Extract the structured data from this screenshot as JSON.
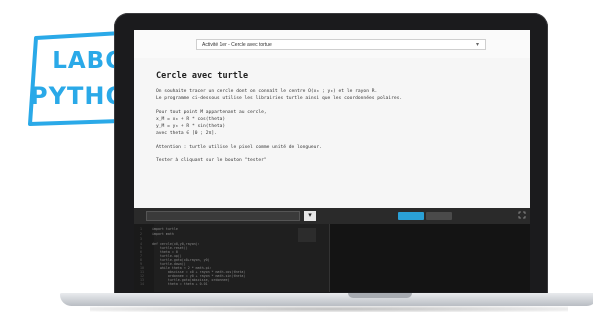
{
  "logo": {
    "line1": "LABO",
    "line2": "PYTHON",
    "color": "#2aa9e8"
  },
  "app": {
    "exercise_select": {
      "value": "Activité 1er - Cercle avec tortue"
    }
  },
  "document": {
    "title": "Cercle avec turtle",
    "lines": [
      "On souhaite tracer un cercle dont on connaît le centre O(x₀ ; y₀) et le rayon R.",
      "Le programme ci-dessous utilise les librairies turtle ainsi que les coordonnées polaires.",
      "",
      "Pour tout point M appartenant au cercle,",
      "x_M = x₀ + R * cos(theta)",
      "y_M = y₀ + R * sin(theta)",
      "avec theta ∈ [0 ; 2π].",
      "",
      "Attention : turtle utilise le pixel comme unité de longueur.",
      "",
      "Tester à cliquant sur le bouton \"tester\""
    ]
  },
  "editor": {
    "run_button_label": "Exécuter le code (Ctrl+Entrée)",
    "tabs": {
      "console": "Console",
      "graphics": "Graphique"
    },
    "code_lines": [
      "import turtle",
      "import math",
      "",
      "def cercle(x0,y0,rayon):",
      "    turtle.reset()",
      "    theta = 0",
      "    turtle.up()",
      "    turtle.goto(x0+rayon, y0)",
      "    turtle.down()",
      "    while theta < 2 * math.pi:",
      "        abscisse = x0 + rayon * math.cos(theta)",
      "        ordonnee = y0 + rayon * math.sin(theta)",
      "        turtle.goto(abscisse, ordonnee)",
      "        theta = theta + 0.01"
    ]
  }
}
